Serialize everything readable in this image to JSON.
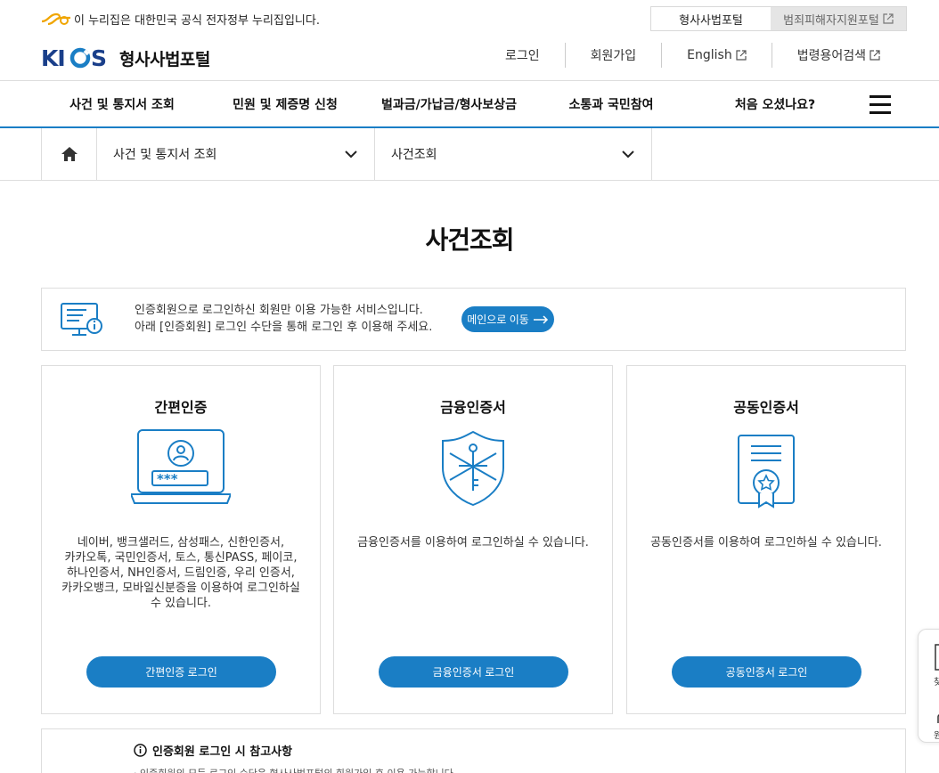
{
  "gov_bar": {
    "notice": "이 누리집은 대한민국 공식 전자정부 누리집입니다.",
    "tabs": [
      {
        "label": "형사사법포털",
        "active": true
      },
      {
        "label": "범죄피해자지원포털",
        "active": false
      }
    ]
  },
  "header": {
    "logo_text": "KICS",
    "site_title": "형사사법포털",
    "util": [
      "로그인",
      "회원가입",
      "English",
      "법령용어검색"
    ]
  },
  "gnb": {
    "items": [
      "사건 및 통지서 조회",
      "민원 및 제증명 신청",
      "벌과금/가납금/형사보상금",
      "소통과 국민참여",
      "처음 오셨나요?"
    ]
  },
  "breadcrumb": {
    "level1": "사건 및 통지서 조회",
    "level2": "사건조회"
  },
  "page": {
    "title": "사건조회"
  },
  "notice": {
    "line1": "인증회원으로 로그인하신 회원만 이용 가능한 서비스입니다.",
    "line2": "아래 [인증회원] 로그인 수단을 통해 로그인 후 이용해 주세요.",
    "button": "메인으로 이동"
  },
  "cards": [
    {
      "title": "간편인증",
      "icon": "laptop-user-icon",
      "password_mask": "***",
      "desc_lines": [
        "네이버, 뱅크샐러드, 삼성패스, 신한인증서,",
        "카카오톡, 국민인증서, 토스, 통신PASS, 페이코,",
        "하나인증서, NH인증서, 드림인증, 우리 인증서,",
        "카카오뱅크, 모바일신분증을 이용하여 로그인하실",
        "수 있습니다."
      ],
      "button": "간편인증 로그인"
    },
    {
      "title": "금융인증서",
      "icon": "shield-key-icon",
      "desc_lines": [
        "금융인증서를 이용하여 로그인하실 수 있습니다."
      ],
      "button": "금융인증서 로그인"
    },
    {
      "title": "공동인증서",
      "icon": "certificate-icon",
      "desc_lines": [
        "공동인증서를 이용하여 로그인하실 수 있습니다."
      ],
      "button": "공동인증서 로그인"
    }
  ],
  "reference": {
    "title": "인증회원 로그인 시 참고사항",
    "line1": "· 인증회원의 모든 로그인 수단은 형사사법포털의 회원가입 후 이용 가능합니다."
  },
  "quick_menu": {
    "labels": [
      "찾",
      "원격"
    ]
  },
  "colors": {
    "accent": "#1a7ec5",
    "logo": "#1a3f8a",
    "gov_logo": "#f0a500"
  }
}
